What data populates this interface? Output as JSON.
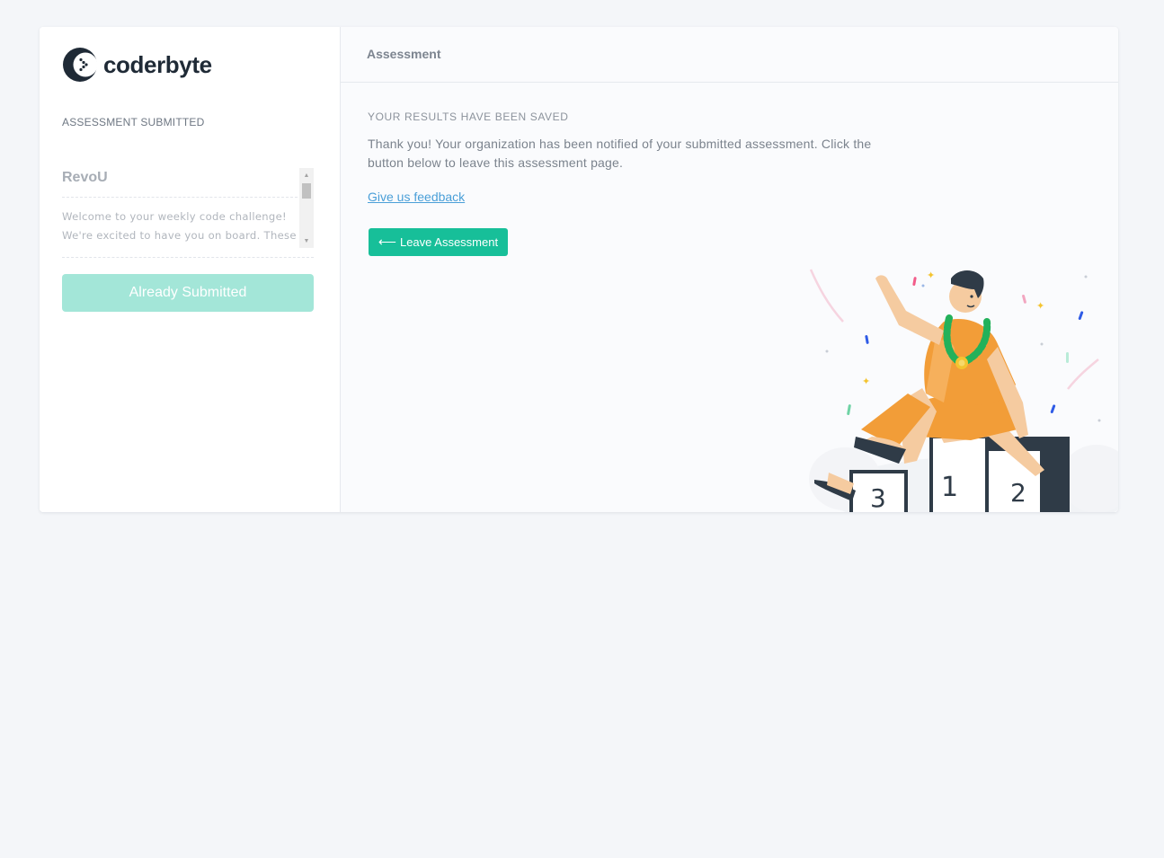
{
  "brand": {
    "name": "coderbyte",
    "accent": "#17bf99",
    "dark": "#1f2a36"
  },
  "sidebar": {
    "status_label": "ASSESSMENT SUBMITTED",
    "organization": {
      "name": "RevoU",
      "description": "Welcome to your weekly code challenge!\nWe're excited to have you on board. These"
    },
    "submit_button": "Already Submitted"
  },
  "main": {
    "header_title": "Assessment",
    "heading": "YOUR RESULTS HAVE BEEN SAVED",
    "message": "Thank you! Your organization has been notified of your submitted assessment. Click the button below to leave this assessment page.",
    "feedback_link": "Give us feedback",
    "leave_button": "Leave Assessment",
    "leave_icon": "arrow-left-icon",
    "illustration": {
      "description": "podium-celebration",
      "podium_labels": [
        "1",
        "2",
        "3"
      ]
    }
  }
}
